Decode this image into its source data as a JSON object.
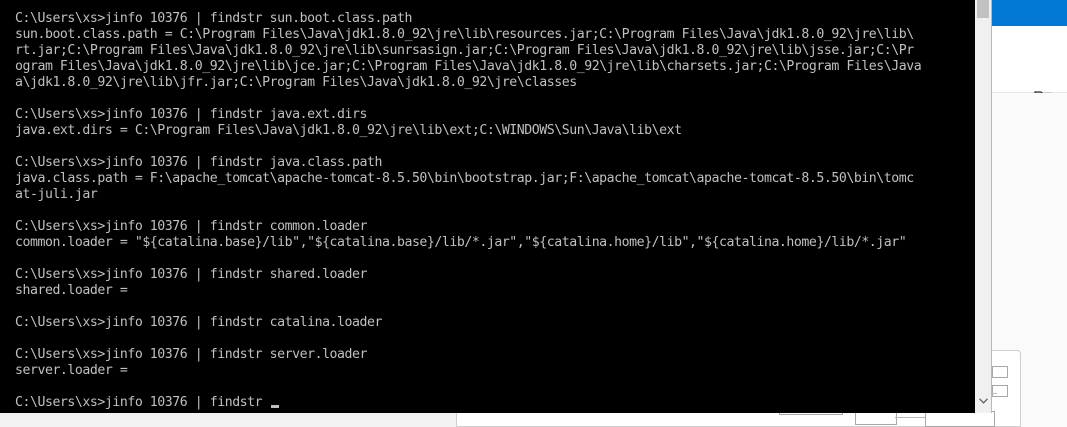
{
  "console": {
    "lines": [
      "C:\\Users\\xs>jinfo 10376 | findstr sun.boot.class.path",
      "sun.boot.class.path = C:\\Program Files\\Java\\jdk1.8.0_92\\jre\\lib\\resources.jar;C:\\Program Files\\Java\\jdk1.8.0_92\\jre\\lib\\",
      "rt.jar;C:\\Program Files\\Java\\jdk1.8.0_92\\jre\\lib\\sunrsasign.jar;C:\\Program Files\\Java\\jdk1.8.0_92\\jre\\lib\\jsse.jar;C:\\Pr",
      "ogram Files\\Java\\jdk1.8.0_92\\jre\\lib\\jce.jar;C:\\Program Files\\Java\\jdk1.8.0_92\\jre\\lib\\charsets.jar;C:\\Program Files\\Java",
      "a\\jdk1.8.0_92\\jre\\lib\\jfr.jar;C:\\Program Files\\Java\\jdk1.8.0_92\\jre\\classes",
      "",
      "C:\\Users\\xs>jinfo 10376 | findstr java.ext.dirs",
      "java.ext.dirs = C:\\Program Files\\Java\\jdk1.8.0_92\\jre\\lib\\ext;C:\\WINDOWS\\Sun\\Java\\lib\\ext",
      "",
      "C:\\Users\\xs>jinfo 10376 | findstr java.class.path",
      "java.class.path = F:\\apache_tomcat\\apache-tomcat-8.5.50\\bin\\bootstrap.jar;F:\\apache_tomcat\\apache-tomcat-8.5.50\\bin\\tomc",
      "at-juli.jar",
      "",
      "C:\\Users\\xs>jinfo 10376 | findstr common.loader",
      "common.loader = \"${catalina.base}/lib\",\"${catalina.base}/lib/*.jar\",\"${catalina.home}/lib\",\"${catalina.home}/lib/*.jar\"",
      "",
      "C:\\Users\\xs>jinfo 10376 | findstr shared.loader",
      "shared.loader =",
      "",
      "C:\\Users\\xs>jinfo 10376 | findstr catalina.loader",
      "",
      "C:\\Users\\xs>jinfo 10376 | findstr server.loader",
      "server.loader =",
      "",
      "C:\\Users\\xs>jinfo 10376 | findstr "
    ]
  },
  "colors": {
    "console_bg": "#000000",
    "console_fg": "#c0c0c0",
    "accent": "#0078d4"
  },
  "icons": {
    "folder": "folder-icon",
    "scroll_down": "chevron-down-icon"
  }
}
